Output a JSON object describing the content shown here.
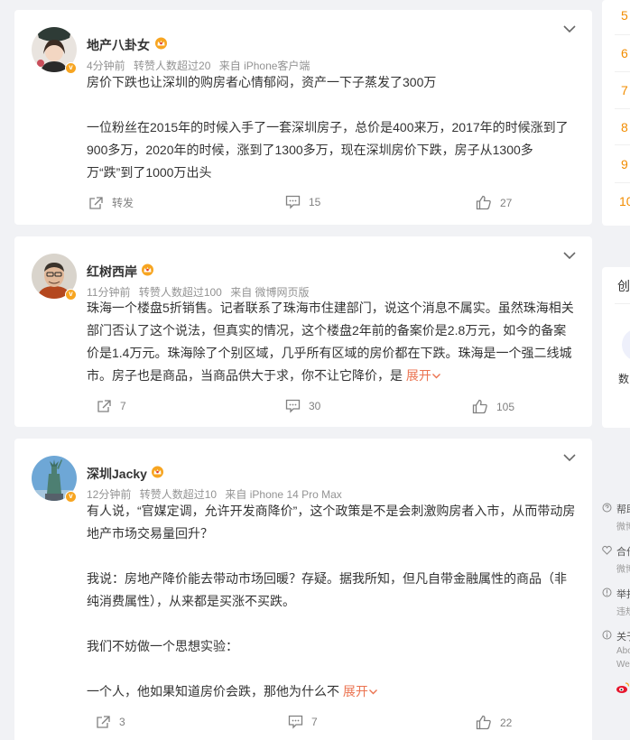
{
  "posts": [
    {
      "username": "地产八卦女",
      "time": "4分钟前",
      "reposts": "转赞人数超过20",
      "source": "来自 iPhone客户端",
      "paragraphs": [
        "房价下跌也让深圳的购房者心情郁闷，资产一下子蒸发了300万",
        "一位粉丝在2015年的时候入手了一套深圳房子，总价是400来万，2017年的时候涨到了900多万，2020年的时候，涨到了1300多万，现在深圳房价下跌，房子从1300多万“跌”到了1000万出头"
      ],
      "actions": {
        "repost": "转发",
        "comment": "15",
        "like": "27"
      }
    },
    {
      "username": "红树西岸",
      "time": "11分钟前",
      "reposts": "转赞人数超过100",
      "source": "来自 微博网页版",
      "paragraphs": [
        "珠海一个楼盘5折销售。记者联系了珠海市住建部门，说这个消息不属实。虽然珠海相关部门否认了这个说法，但真实的情况，这个楼盘2年前的备案价是2.8万元，如今的备案价是1.4万元。珠海除了个别区域，几乎所有区域的房价都在下跌。珠海是一个强二线城市。房子也是商品，当商品供大于求，你不让它降价，是 "
      ],
      "expand": "展开",
      "actions": {
        "repost": "7",
        "comment": "30",
        "like": "105"
      }
    },
    {
      "username": "深圳Jacky",
      "time": "12分钟前",
      "reposts": "转赞人数超过10",
      "source": "来自 iPhone 14 Pro Max",
      "paragraphs": [
        "有人说，“官媒定调，允许开发商降价”，这个政策是不是会刺激购房者入市，从而带动房地产市场交易量回升？",
        "我说：房地产降价能去带动市场回暖？存疑。据我所知，但凡自带金融属性的商品（非纯消费属性），从来都是买涨不买跌。",
        "我们不妨做一个思想实验：",
        "一个人，他如果知道房价会跌，那他为什么不 "
      ],
      "expand": "展开",
      "actions": {
        "repost": "3",
        "comment": "7",
        "like": "22"
      }
    }
  ],
  "sidebar": {
    "rank_numbers": [
      "5",
      "6",
      "7",
      "8",
      "9",
      "10"
    ],
    "card_title_partial": "创",
    "card_label_partial": "数",
    "footer": [
      {
        "icon": "help-icon",
        "title": "帮助",
        "sub": "微博"
      },
      {
        "icon": "cooperation-icon",
        "title": "合作",
        "sub": "微博"
      },
      {
        "icon": "report-icon",
        "title": "举报",
        "sub": "违规"
      },
      {
        "icon": "info-icon",
        "title": "关于",
        "sub": "Abo"
      },
      {
        "icon": "",
        "title": "",
        "sub": "We"
      }
    ]
  },
  "colors": {
    "accent": "#eb7350",
    "rank": "#f28c00",
    "vip": "#f7a521",
    "background": "#f1f2f5"
  }
}
